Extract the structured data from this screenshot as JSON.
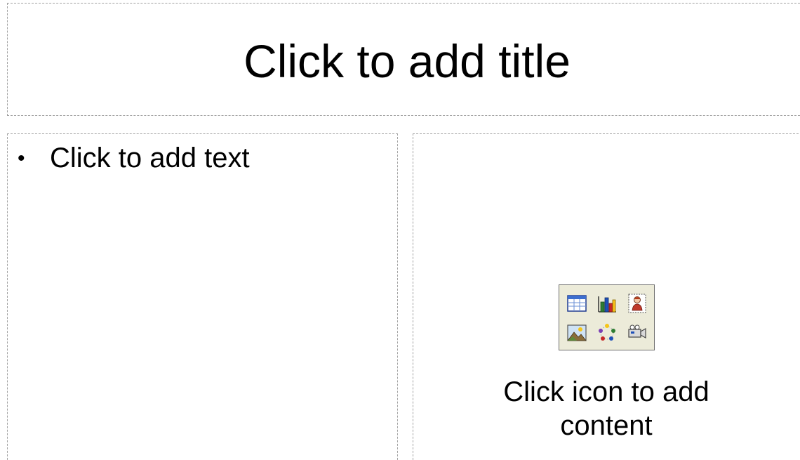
{
  "slide": {
    "title_placeholder": "Click to add title",
    "text_placeholder": {
      "bullet": "•",
      "text": "Click to add text"
    },
    "content_placeholder": {
      "caption": "Click icon to add content",
      "icons": [
        "table-icon",
        "chart-icon",
        "clip-art-icon",
        "picture-icon",
        "diagram-icon",
        "media-clip-icon"
      ]
    }
  }
}
